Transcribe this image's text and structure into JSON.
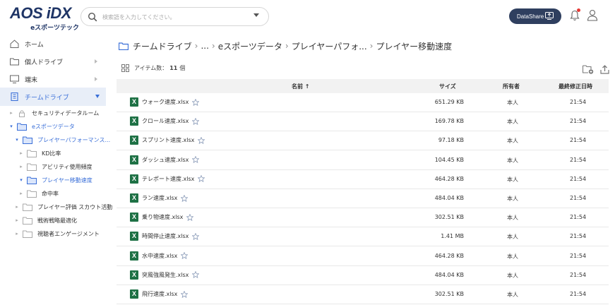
{
  "header": {
    "logo_main": "AOS iDX",
    "logo_sub": "eスポーツテック",
    "search_placeholder": "検索語を入力してください。",
    "datashare_label": "DataShare"
  },
  "sidebar": {
    "nav": [
      {
        "label": "ホーム",
        "icon": "home-icon"
      },
      {
        "label": "個人ドライブ",
        "icon": "folder-icon"
      },
      {
        "label": "端末",
        "icon": "monitor-icon"
      },
      {
        "label": "チームドライブ",
        "icon": "building-icon"
      }
    ],
    "tree": [
      {
        "label": "セキュリティデータルーム"
      },
      {
        "label": "eスポーツデータ"
      },
      {
        "label": "プレイヤーパフォーマンス..."
      },
      {
        "label": "KD比率"
      },
      {
        "label": "アビリティ使用頻度"
      },
      {
        "label": "プレイヤー移動速度"
      },
      {
        "label": "命中率"
      },
      {
        "label": "プレイヤー評価 スカウト活動"
      },
      {
        "label": "戦術戦略最適化"
      },
      {
        "label": "視聴者エンゲージメント"
      }
    ]
  },
  "breadcrumb": {
    "items": [
      "チームドライブ",
      "...",
      "eスポーツデータ",
      "プレイヤーパフォ...",
      "プレイヤー移動速度"
    ]
  },
  "toolbar": {
    "count_label": "アイテム数：",
    "count_value": "11",
    "count_unit": "個"
  },
  "table": {
    "headers": {
      "name": "名前 ↑",
      "size": "サイズ",
      "owner": "所有者",
      "modified": "最終修正日時"
    },
    "rows": [
      {
        "name": "ウォーク速度.xlsx",
        "size": "651.29 KB",
        "owner": "本人",
        "modified": "21:54"
      },
      {
        "name": "クロール速度.xlsx",
        "size": "169.78 KB",
        "owner": "本人",
        "modified": "21:54"
      },
      {
        "name": "スプリント速度.xlsx",
        "size": "97.18 KB",
        "owner": "本人",
        "modified": "21:54"
      },
      {
        "name": "ダッシュ速度.xlsx",
        "size": "104.45 KB",
        "owner": "本人",
        "modified": "21:54"
      },
      {
        "name": "テレポート速度.xlsx",
        "size": "464.28 KB",
        "owner": "本人",
        "modified": "21:54"
      },
      {
        "name": "ラン速度.xlsx",
        "size": "484.04 KB",
        "owner": "本人",
        "modified": "21:54"
      },
      {
        "name": "乗り物速度.xlsx",
        "size": "302.51 KB",
        "owner": "本人",
        "modified": "21:54"
      },
      {
        "name": "時間停止速度.xlsx",
        "size": "1.41 MB",
        "owner": "本人",
        "modified": "21:54"
      },
      {
        "name": "水中速度.xlsx",
        "size": "464.28 KB",
        "owner": "本人",
        "modified": "21:54"
      },
      {
        "name": "突風強風発生.xlsx",
        "size": "484.04 KB",
        "owner": "本人",
        "modified": "21:54"
      },
      {
        "name": "飛行速度.xlsx",
        "size": "302.51 KB",
        "owner": "本人",
        "modified": "21:54"
      }
    ]
  },
  "colors": {
    "accent": "#3a6fd8",
    "brand": "#1f3566",
    "excel": "#1e7145"
  }
}
